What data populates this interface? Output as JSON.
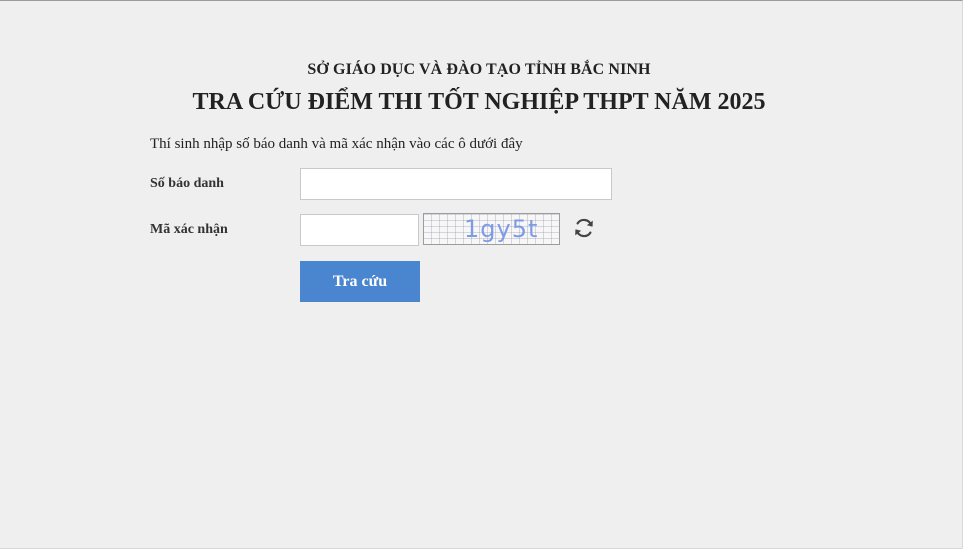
{
  "header": {
    "organization": "SỞ GIÁO DỤC VÀ ĐÀO TẠO TỈNH BẮC NINH",
    "title": "TRA CỨU ĐIỂM THI TỐT NGHIỆP THPT NĂM 2025"
  },
  "form": {
    "instruction": "Thí sinh nhập số báo danh và mã xác nhận vào các ô dưới đây",
    "candidate_number": {
      "label": "Số báo danh",
      "value": "",
      "placeholder": ""
    },
    "captcha": {
      "label": "Mã xác nhận",
      "value": "",
      "placeholder": "",
      "image_text": "1gy5t",
      "refresh_icon": "refresh-icon"
    },
    "submit_label": "Tra cứu"
  },
  "colors": {
    "background": "#efefef",
    "button": "#4a86cf",
    "button_text": "#ffffff",
    "captcha_text": "#7f9be6"
  }
}
